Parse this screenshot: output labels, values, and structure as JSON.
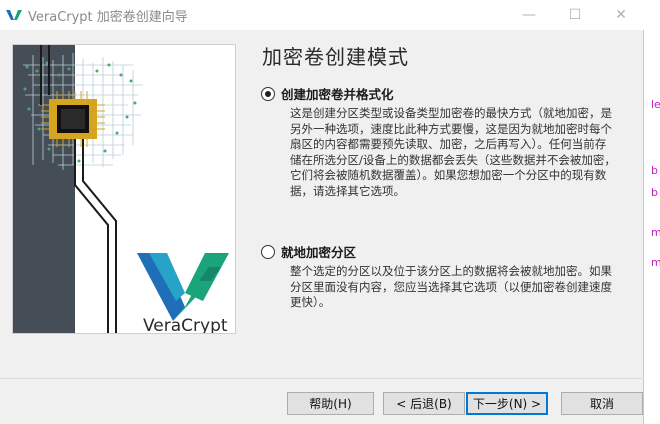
{
  "window": {
    "title": "VeraCrypt 加密卷创建向导",
    "minimize_label": "—",
    "maximize_label": "☐",
    "close_label": "✕"
  },
  "banner": {
    "logo_text": "VeraCrypt"
  },
  "page": {
    "heading": "加密卷创建模式"
  },
  "options": [
    {
      "label": "创建加密卷并格式化",
      "selected": true,
      "description": "这是创建分区类型或设备类型加密卷的最快方式（就地加密，是\n另外一种选项，速度比此种方式要慢，这是因为就地加密时每个\n扇区的内容都需要预先读取、加密，之后再写入）。任何当前存\n储在所选分区/设备上的数据都会丢失（这些数据并不会被加密，\n它们将会被随机数据覆盖）。如果您想加密一个分区中的现有数\n据，请选择其它选项。"
    },
    {
      "label": "就地加密分区",
      "selected": false,
      "description": "整个选定的分区以及位于该分区上的数据将会被就地加密。如果\n分区里面没有内容，您应当选择其它选项（以便加密卷创建速度\n更快）。"
    }
  ],
  "buttons": {
    "help": "帮助(H)",
    "back": "< 后退(B)",
    "next": "下一步(N) >",
    "cancel": "取消"
  },
  "background_glyphs": [
    "le",
    "b",
    "b",
    "m",
    "m"
  ],
  "colors": {
    "logo_blue": "#1f6fb8",
    "logo_teal": "#1ba37a",
    "chip_gold": "#d6a520"
  }
}
